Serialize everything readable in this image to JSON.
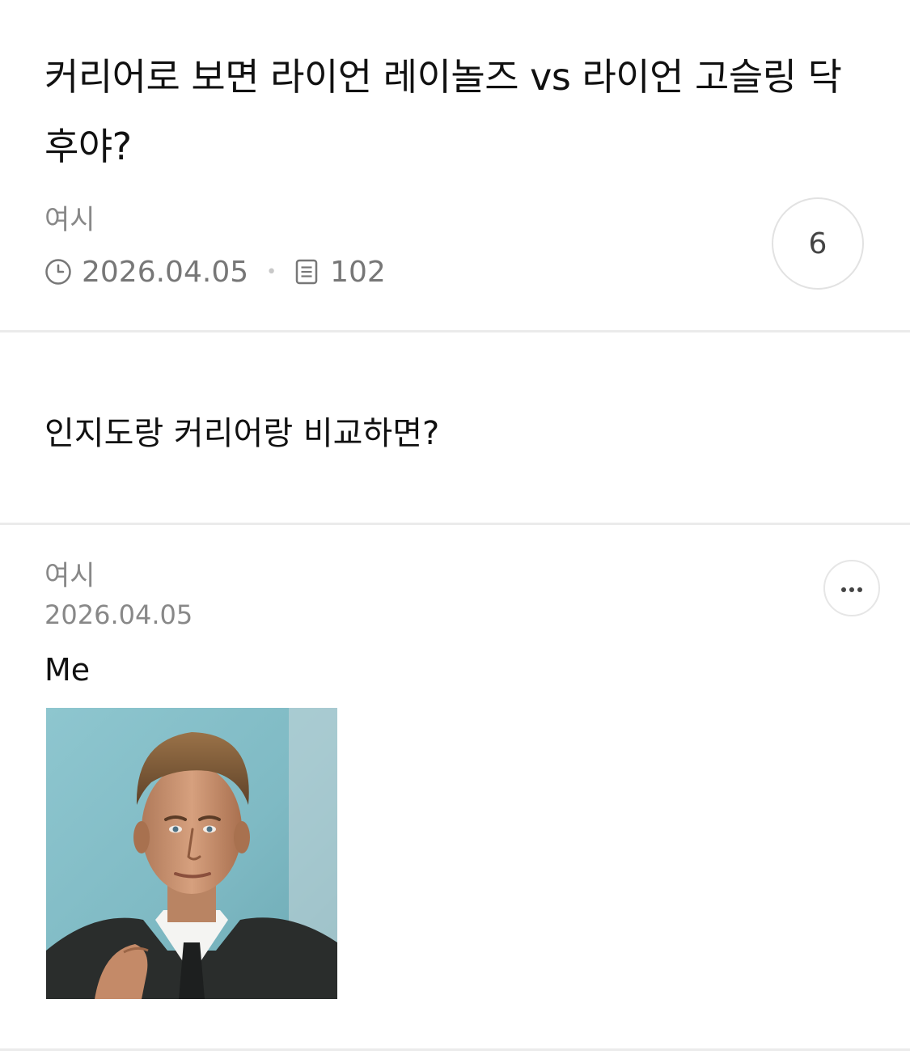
{
  "post": {
    "title": "커리어로 보면 라이언 레이놀즈 vs 라이언 고슬링 닥 후야?",
    "author": "여시",
    "date": "2026.04.05",
    "views": "102",
    "comment_count": "6",
    "body": "인지도랑 커리어랑 비교하면?"
  },
  "comment": {
    "author": "여시",
    "date": "2026.04.05",
    "text": "Me"
  },
  "icons": {
    "date": "clock-icon",
    "views": "document-icon",
    "more": "more-dots-icon"
  }
}
